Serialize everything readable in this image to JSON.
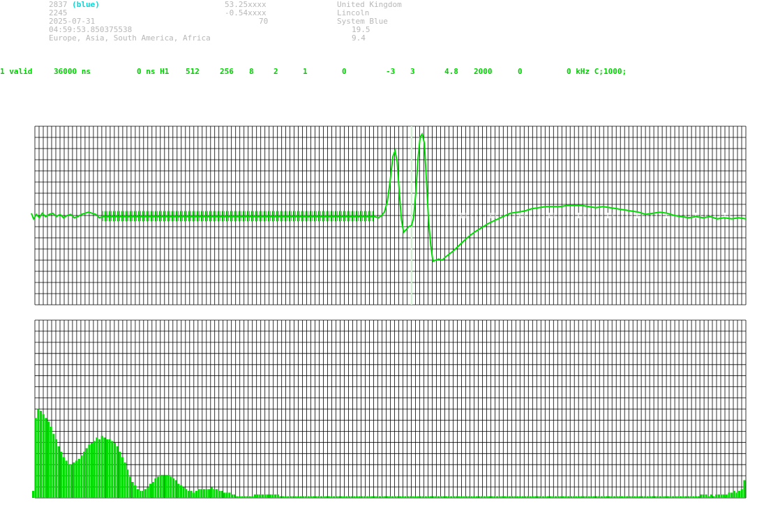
{
  "header": {
    "col1": {
      "id": "2837",
      "id_tag": "(blue)",
      "line2": "2245",
      "date": "2025-07-31",
      "time": "04:59:53.850375538",
      "regions": "Europe, Asia, South America, Africa"
    },
    "col2": {
      "lat": "53.25xxxx",
      "lon": "-0.54xxxx",
      "alt": "70"
    },
    "col3": {
      "country": "United Kingdom",
      "city": "Lincoln",
      "system": "System Blue",
      "val1": "19.5",
      "val2": "9.4"
    }
  },
  "status_fields": [
    "1 valid",
    "36000 ns",
    "0 ns H1",
    "512",
    "256",
    "8",
    "2",
    "1",
    "0",
    "-3",
    "3",
    "4.8",
    "2000",
    "0",
    "0 kHz C;1000;"
  ],
  "colors": {
    "grid": "#000000",
    "trace": "#00dd00",
    "bars": "#00dd00",
    "text_gray": "#b8b8b8",
    "accent": "#00d8d8",
    "marker_line": "#c8f0c8",
    "white_ticks": "#ffffff"
  },
  "chart_data": [
    {
      "type": "line",
      "title": "",
      "xlabel": "",
      "ylabel": "",
      "grid": true,
      "marker_x": 0.532,
      "ylim": [
        -8,
        8
      ],
      "points": [
        [
          0.0,
          0.2
        ],
        [
          0.003,
          -0.3
        ],
        [
          0.007,
          0.1
        ],
        [
          0.011,
          -0.2
        ],
        [
          0.015,
          0.2
        ],
        [
          0.02,
          -0.1
        ],
        [
          0.025,
          0.1
        ],
        [
          0.03,
          0.2
        ],
        [
          0.035,
          -0.1
        ],
        [
          0.04,
          0.1
        ],
        [
          0.045,
          -0.2
        ],
        [
          0.05,
          0.0
        ],
        [
          0.055,
          0.1
        ],
        [
          0.06,
          -0.2
        ],
        [
          0.065,
          -0.1
        ],
        [
          0.07,
          0.1
        ],
        [
          0.075,
          0.2
        ],
        [
          0.08,
          0.3
        ],
        [
          0.085,
          0.2
        ],
        [
          0.09,
          0.1
        ],
        [
          0.095,
          -0.2
        ],
        [
          0.1,
          -0.1
        ],
        [
          0.15,
          -0.1
        ],
        [
          0.2,
          -0.1
        ],
        [
          0.25,
          -0.1
        ],
        [
          0.3,
          -0.1
        ],
        [
          0.35,
          -0.1
        ],
        [
          0.4,
          -0.1
        ],
        [
          0.45,
          -0.1
        ],
        [
          0.48,
          -0.1
        ],
        [
          0.486,
          -0.2
        ],
        [
          0.49,
          0.0
        ],
        [
          0.494,
          0.3
        ],
        [
          0.498,
          1.2
        ],
        [
          0.502,
          3.0
        ],
        [
          0.506,
          5.3
        ],
        [
          0.509,
          5.8
        ],
        [
          0.512,
          4.8
        ],
        [
          0.515,
          2.0
        ],
        [
          0.518,
          -0.4
        ],
        [
          0.521,
          -1.5
        ],
        [
          0.524,
          -1.3
        ],
        [
          0.528,
          -1.0
        ],
        [
          0.532,
          -0.9
        ],
        [
          0.535,
          -0.2
        ],
        [
          0.538,
          2.0
        ],
        [
          0.541,
          5.0
        ],
        [
          0.544,
          7.0
        ],
        [
          0.547,
          7.3
        ],
        [
          0.55,
          6.5
        ],
        [
          0.553,
          3.0
        ],
        [
          0.556,
          -0.5
        ],
        [
          0.559,
          -2.7
        ],
        [
          0.562,
          -4.1
        ],
        [
          0.566,
          -4.0
        ],
        [
          0.57,
          -3.9
        ],
        [
          0.575,
          -4.0
        ],
        [
          0.58,
          -3.7
        ],
        [
          0.59,
          -3.2
        ],
        [
          0.6,
          -2.6
        ],
        [
          0.61,
          -2.0
        ],
        [
          0.62,
          -1.5
        ],
        [
          0.63,
          -1.1
        ],
        [
          0.64,
          -0.7
        ],
        [
          0.65,
          -0.4
        ],
        [
          0.66,
          -0.1
        ],
        [
          0.67,
          0.2
        ],
        [
          0.68,
          0.3
        ],
        [
          0.69,
          0.4
        ],
        [
          0.7,
          0.6
        ],
        [
          0.71,
          0.7
        ],
        [
          0.72,
          0.8
        ],
        [
          0.73,
          0.8
        ],
        [
          0.74,
          0.8
        ],
        [
          0.75,
          0.9
        ],
        [
          0.76,
          0.9
        ],
        [
          0.77,
          0.9
        ],
        [
          0.78,
          0.8
        ],
        [
          0.79,
          0.7
        ],
        [
          0.8,
          0.8
        ],
        [
          0.81,
          0.7
        ],
        [
          0.82,
          0.6
        ],
        [
          0.83,
          0.5
        ],
        [
          0.84,
          0.4
        ],
        [
          0.85,
          0.3
        ],
        [
          0.86,
          0.1
        ],
        [
          0.87,
          0.2
        ],
        [
          0.88,
          0.3
        ],
        [
          0.89,
          0.2
        ],
        [
          0.9,
          0.0
        ],
        [
          0.91,
          -0.1
        ],
        [
          0.92,
          -0.2
        ],
        [
          0.93,
          -0.1
        ],
        [
          0.94,
          -0.2
        ],
        [
          0.95,
          -0.1
        ],
        [
          0.96,
          -0.3
        ],
        [
          0.97,
          -0.2
        ],
        [
          0.98,
          -0.3
        ],
        [
          0.99,
          -0.2
        ],
        [
          1.0,
          -0.3
        ]
      ]
    },
    {
      "type": "bar",
      "title": "",
      "xlabel": "",
      "ylabel": "",
      "grid": true,
      "ylim": [
        0,
        1
      ],
      "values": [
        0.04,
        0.45,
        0.5,
        0.49,
        0.47,
        0.45,
        0.43,
        0.4,
        0.36,
        0.33,
        0.29,
        0.26,
        0.23,
        0.21,
        0.19,
        0.19,
        0.2,
        0.21,
        0.22,
        0.24,
        0.26,
        0.28,
        0.3,
        0.31,
        0.32,
        0.34,
        0.33,
        0.35,
        0.34,
        0.33,
        0.33,
        0.32,
        0.31,
        0.29,
        0.26,
        0.23,
        0.2,
        0.16,
        0.12,
        0.09,
        0.07,
        0.05,
        0.04,
        0.04,
        0.05,
        0.06,
        0.08,
        0.09,
        0.11,
        0.12,
        0.13,
        0.13,
        0.13,
        0.13,
        0.12,
        0.11,
        0.1,
        0.08,
        0.07,
        0.06,
        0.05,
        0.04,
        0.04,
        0.03,
        0.04,
        0.05,
        0.05,
        0.05,
        0.05,
        0.05,
        0.06,
        0.05,
        0.05,
        0.04,
        0.04,
        0.03,
        0.03,
        0.03,
        0.02,
        0.02,
        0.01,
        0.01,
        0.01,
        0.01,
        0.01,
        0.01,
        0.01,
        0.02,
        0.02,
        0.02,
        0.02,
        0.02,
        0.02,
        0.02,
        0.02,
        0.02,
        0.02,
        0.01,
        0.01,
        0.01,
        0.01,
        0.01,
        0.01,
        0.01,
        0.01,
        0.01,
        0.01,
        0.01,
        0.01,
        0.01,
        0.01,
        0.01,
        0.01,
        0.01,
        0.01,
        0.01,
        0.01,
        0.01,
        0.01,
        0.01,
        0.01,
        0.01,
        0.01,
        0.01,
        0.01,
        0.01,
        0.01,
        0.01,
        0.01,
        0.01,
        0.01,
        0.01,
        0.01,
        0.01,
        0.01,
        0.01,
        0.01,
        0.01,
        0.01,
        0.01,
        0.01,
        0.01,
        0.01,
        0.01,
        0.01,
        0.01,
        0.01,
        0.01,
        0.01,
        0.01,
        0.01,
        0.01,
        0.01,
        0.01,
        0.01,
        0.01,
        0.01,
        0.01,
        0.01,
        0.01,
        0.01,
        0.01,
        0.01,
        0.01,
        0.01,
        0.01,
        0.01,
        0.01,
        0.01,
        0.01,
        0.01,
        0.01,
        0.01,
        0.01,
        0.01,
        0.01,
        0.01,
        0.01,
        0.01,
        0.01,
        0.01,
        0.01,
        0.01,
        0.01,
        0.01,
        0.01,
        0.01,
        0.01,
        0.01,
        0.01,
        0.01,
        0.01,
        0.01,
        0.01,
        0.01,
        0.01,
        0.01,
        0.01,
        0.01,
        0.01,
        0.01,
        0.01,
        0.01,
        0.01,
        0.01,
        0.01,
        0.01,
        0.01,
        0.01,
        0.01,
        0.01,
        0.01,
        0.01,
        0.01,
        0.01,
        0.01,
        0.01,
        0.01,
        0.01,
        0.01,
        0.01,
        0.01,
        0.01,
        0.01,
        0.01,
        0.01,
        0.01,
        0.01,
        0.01,
        0.01,
        0.01,
        0.01,
        0.01,
        0.01,
        0.01,
        0.01,
        0.01,
        0.01,
        0.01,
        0.01,
        0.01,
        0.01,
        0.01,
        0.01,
        0.01,
        0.01,
        0.01,
        0.01,
        0.01,
        0.01,
        0.01,
        0.01,
        0.01,
        0.01,
        0.01,
        0.01,
        0.01,
        0.01,
        0.01,
        0.01,
        0.01,
        0.01,
        0.02,
        0.02,
        0.02,
        0.01,
        0.02,
        0.01,
        0.02,
        0.02,
        0.02,
        0.02,
        0.02,
        0.03,
        0.03,
        0.04,
        0.03,
        0.04,
        0.05,
        0.1
      ]
    }
  ]
}
